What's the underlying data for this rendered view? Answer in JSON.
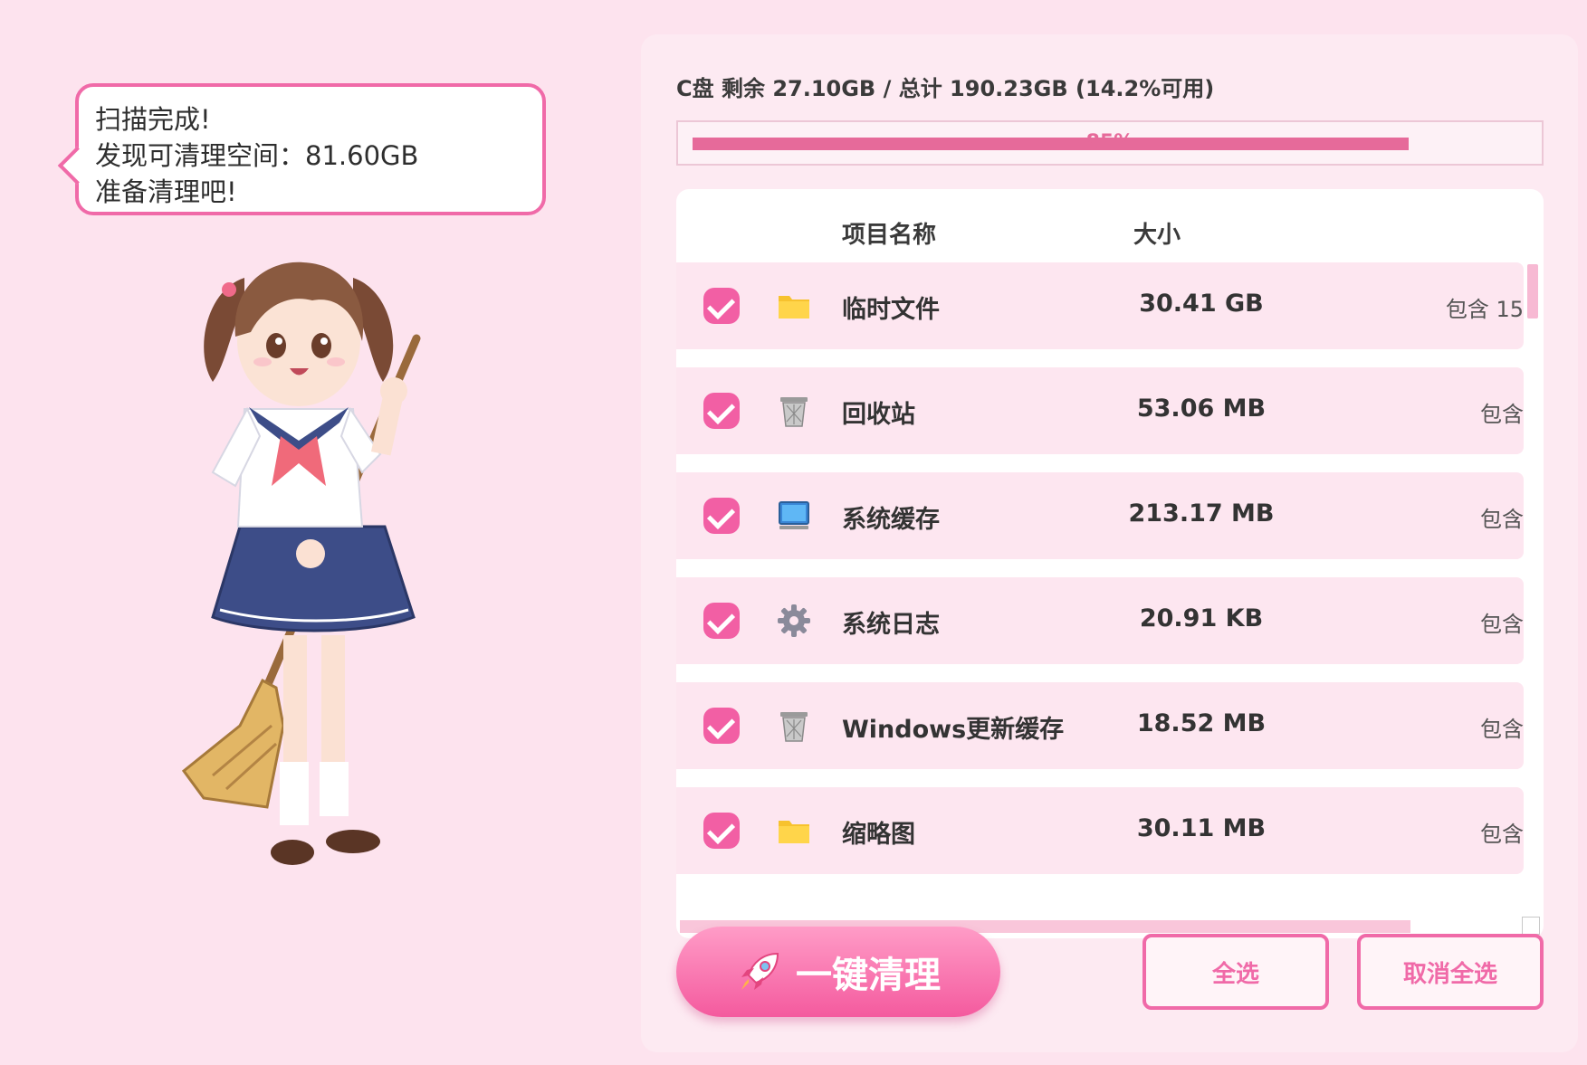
{
  "bubble": {
    "line1": "扫描完成!",
    "line2": "发现可清理空间：81.60GB",
    "line3": "准备清理吧!"
  },
  "disk": {
    "info": "C盘 剩余 27.10GB / 总计 190.23GB (14.2%可用)",
    "progress_label": "85%",
    "used_fraction": 0.858,
    "bar_color": "#e66a9a"
  },
  "table": {
    "col_name": "项目名称",
    "col_size": "大小",
    "rows": [
      {
        "name": "临时文件",
        "size": "30.41 GB",
        "desc": "包含 15",
        "icon": "folder-icon",
        "checked": true
      },
      {
        "name": "回收站",
        "size": "53.06 MB",
        "desc": "包含",
        "icon": "trash-icon",
        "checked": true
      },
      {
        "name": "系统缓存",
        "size": "213.17 MB",
        "desc": "包含",
        "icon": "monitor-icon",
        "checked": true
      },
      {
        "name": "系统日志",
        "size": "20.91 KB",
        "desc": "包含",
        "icon": "gear-icon",
        "checked": true
      },
      {
        "name": "Windows更新缓存",
        "size": "18.52 MB",
        "desc": "包含",
        "icon": "trash-icon",
        "checked": true
      },
      {
        "name": "缩略图",
        "size": "30.11 MB",
        "desc": "包含",
        "icon": "folder-icon",
        "checked": true
      }
    ]
  },
  "buttons": {
    "clean": "一键清理",
    "select_all": "全选",
    "deselect_all": "取消全选"
  },
  "colors": {
    "accent": "#f06aa8",
    "checkbox": "#f25fa4",
    "row_bg": "#fde6f0",
    "page_bg": "#fde3ee"
  }
}
